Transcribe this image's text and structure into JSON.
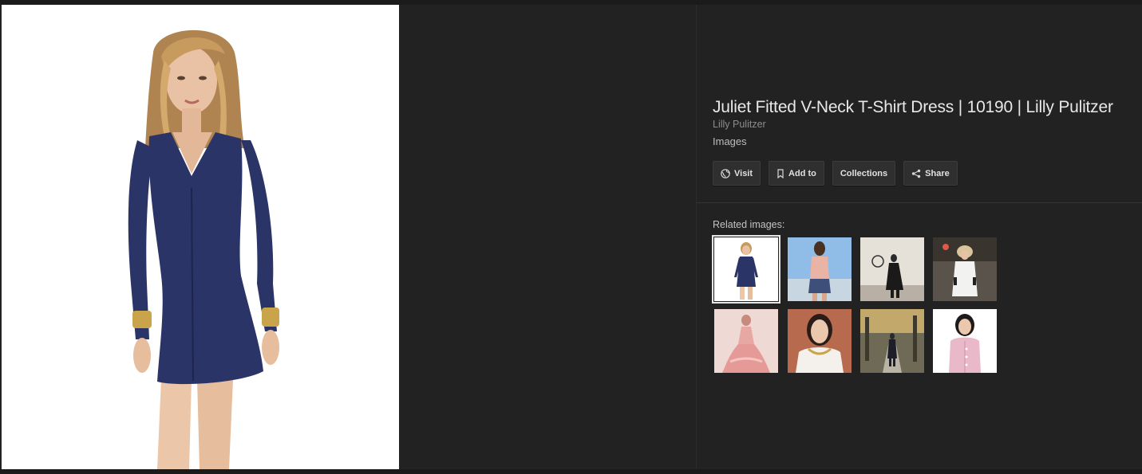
{
  "image": {
    "subject": "woman-in-navy-fitted-v-neck-dress"
  },
  "details": {
    "title": "Juliet Fitted V-Neck T-Shirt Dress | 10190 | Lilly Pulitzer",
    "source": "Lilly Pulitzer",
    "kind": "Images"
  },
  "actions": {
    "visit": {
      "label": "Visit",
      "icon": "globe-icon"
    },
    "add_to": {
      "label": "Add to",
      "icon": "bookmark-icon"
    },
    "collections": {
      "label": "Collections"
    },
    "share": {
      "label": "Share",
      "icon": "share-icon"
    }
  },
  "related": {
    "label": "Related images:",
    "thumbnails": [
      {
        "subject": "navy-dress-model",
        "selected": true
      },
      {
        "subject": "pink-top-patterned-shorts-back"
      },
      {
        "subject": "runway-black-outfit"
      },
      {
        "subject": "runway-white-coat"
      },
      {
        "subject": "pink-ruffle-gown"
      },
      {
        "subject": "white-collar-necklace-portrait"
      },
      {
        "subject": "street-style-autumn-avenue"
      },
      {
        "subject": "pink-cardigan-model"
      }
    ]
  },
  "colors": {
    "background": "#222222",
    "title_text": "#e8e8e8",
    "secondary_text": "#8d8d8d",
    "button_bg": "#2f2f2f",
    "dress_navy": "#2b3466"
  }
}
